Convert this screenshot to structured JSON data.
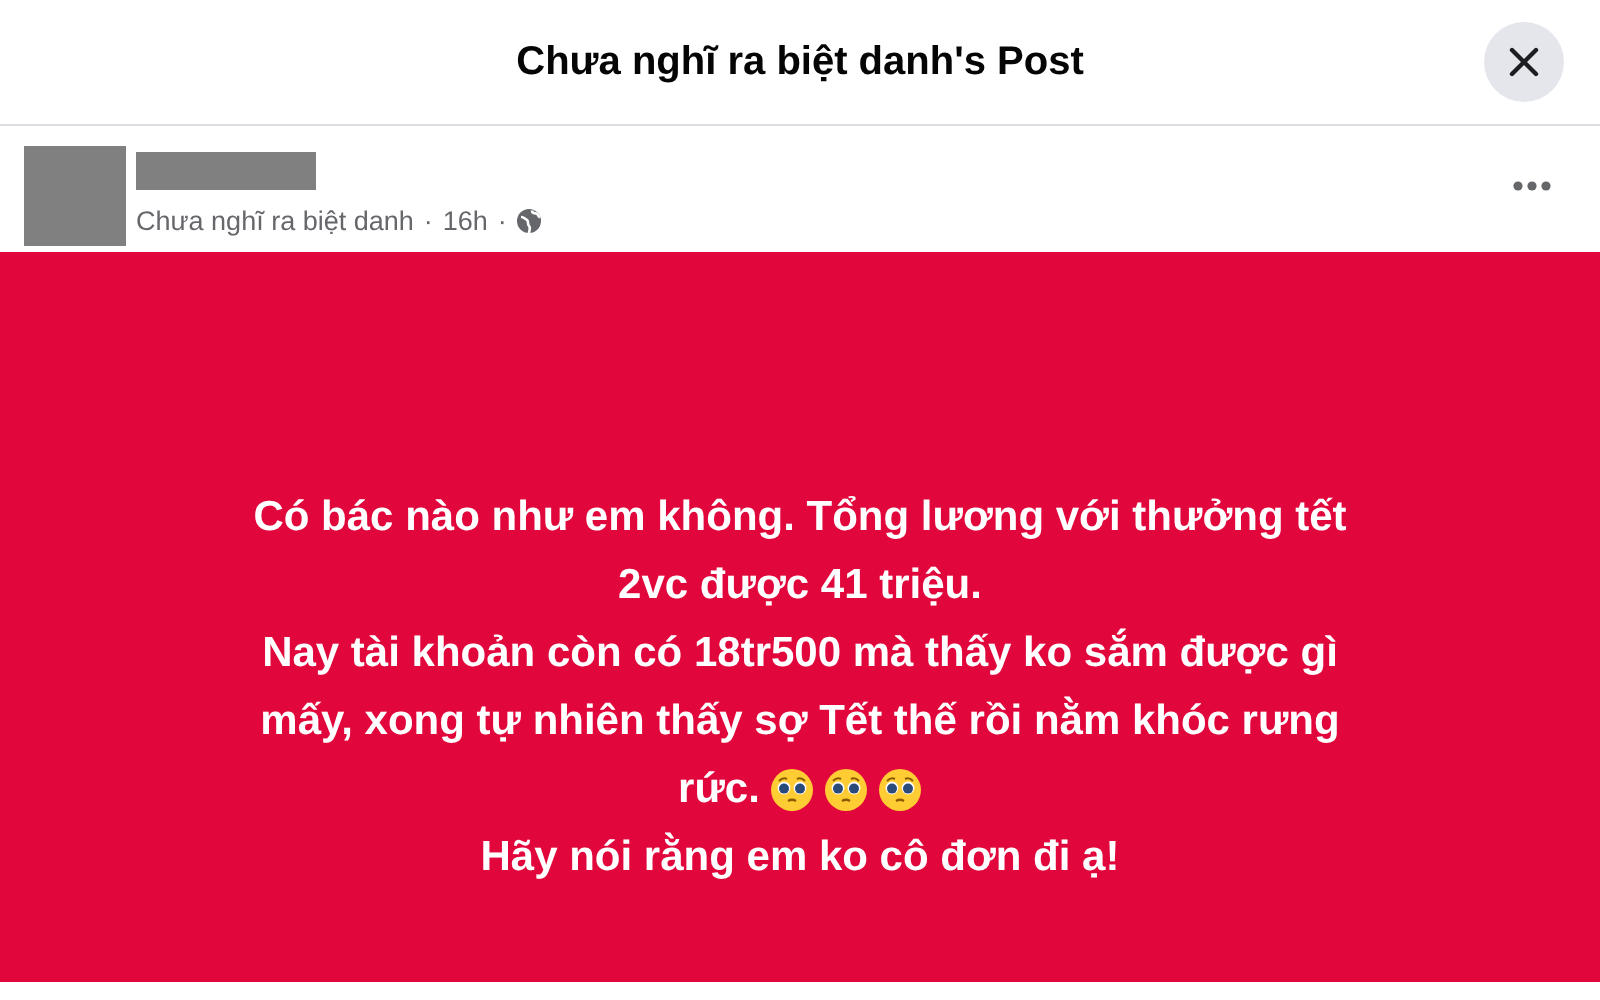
{
  "dialog": {
    "title": "Chưa nghĩ ra biệt danh's Post"
  },
  "post": {
    "author_redacted": true,
    "subtitle": "Chưa nghĩ ra biệt danh",
    "separator_1": "·",
    "time": "16h",
    "separator_2": "·",
    "lines": [
      {
        "text": "Có bác nào như em không. Tổng lương với thưởng tết"
      },
      {
        "text": "2vc được 41 triệu."
      },
      {
        "text": "Nay tài khoản còn có 18tr500 mà thấy ko sắm được gì"
      },
      {
        "text": "mấy, xong tự nhiên thấy sợ Tết thế rồi nằm khóc rưng"
      },
      {
        "text": "rức.",
        "emojis": [
          {
            "kind": "pleading"
          },
          {
            "kind": "pleading"
          },
          {
            "kind": "pleading"
          }
        ]
      },
      {
        "text": "Hãy nói rằng em ko cô đơn đi ạ!"
      }
    ]
  }
}
